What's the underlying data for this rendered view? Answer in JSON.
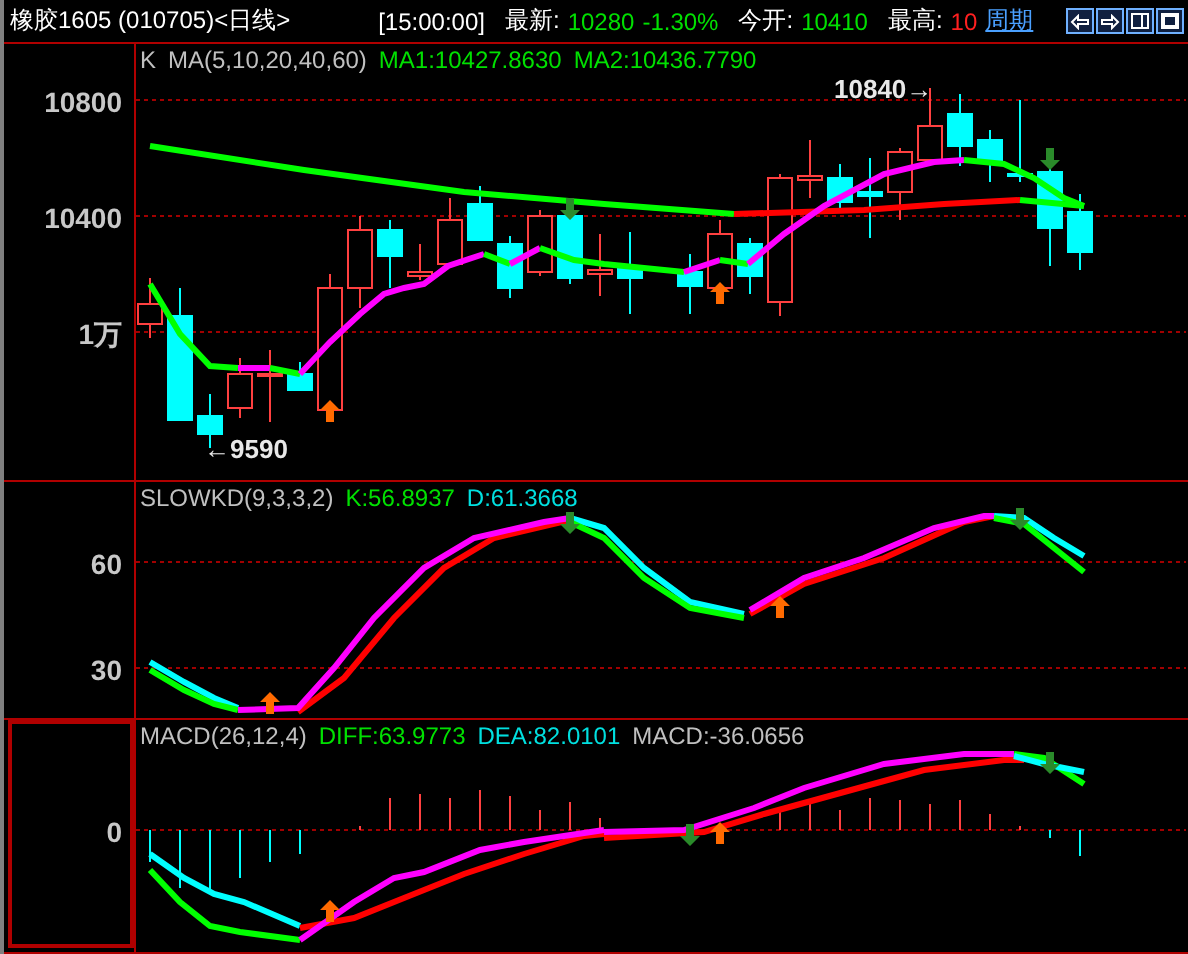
{
  "header": {
    "title": "橡胶1605 (010705)<日线>",
    "time": "[15:00:00]",
    "quotes": [
      {
        "label": "最新:",
        "values": [
          {
            "text": "10280",
            "color": "#00e000"
          },
          {
            "text": "-1.30%",
            "color": "#00e000"
          }
        ]
      },
      {
        "label": "今开:",
        "values": [
          {
            "text": "10410",
            "color": "#00e000"
          }
        ]
      },
      {
        "label": "最高:",
        "values": [
          {
            "text": "10",
            "color": "#ff2020"
          }
        ]
      }
    ],
    "link": "周期",
    "buttons": [
      {
        "kind": "left"
      },
      {
        "kind": "right"
      },
      {
        "kind": "split"
      },
      {
        "kind": "window"
      }
    ]
  },
  "panels": [
    {
      "kind": "main",
      "selected": false,
      "ticks": [
        "10800",
        "10400",
        "1万"
      ],
      "legend": [
        {
          "text": "K",
          "color": "#c0c0c0"
        },
        {
          "text": "MA(5,10,20,40,60)",
          "color": "#c0c0c0"
        },
        {
          "text": "MA1:10427.8630",
          "color": "#00e000"
        },
        {
          "text": "MA2:10436.7790",
          "color": "#00e000"
        }
      ],
      "annotations": [
        "10840→",
        "←9590"
      ]
    },
    {
      "kind": "kd",
      "selected": false,
      "ticks": [
        "60",
        "30"
      ],
      "legend": [
        {
          "text": "SLOWKD(9,3,3,2)",
          "color": "#c0c0c0"
        },
        {
          "text": "K:56.8937",
          "color": "#00e000"
        },
        {
          "text": "D:61.3668",
          "color": "#00e0e0"
        }
      ]
    },
    {
      "kind": "macd",
      "selected": true,
      "ticks": [
        "0"
      ],
      "legend": [
        {
          "text": "MACD(26,12,4)",
          "color": "#c0c0c0"
        },
        {
          "text": "DIFF:63.9773",
          "color": "#00e000"
        },
        {
          "text": "DEA:82.0101",
          "color": "#00e0e0"
        },
        {
          "text": "MACD:-36.0656",
          "color": "#c0c0c0"
        }
      ]
    }
  ]
}
